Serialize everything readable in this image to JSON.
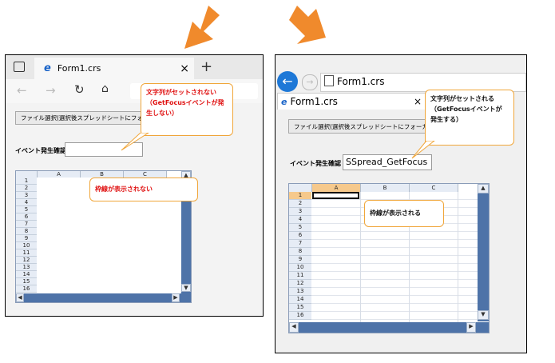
{
  "colors": {
    "accent_orange": "#f08a2c",
    "callout_red": "#e01010",
    "grid_blue": "#4e73a8",
    "back_button": "#1e78d7"
  },
  "left": {
    "tab_title": "Form1.crs",
    "tab_close": "×",
    "new_tab": "+",
    "button_label": "ファイル選択(選択後スプレッドシートにフォーカス)",
    "event_label": "イベント発生確認",
    "event_value": "",
    "callout_top": "文字列がセットされない\n（GetFocusイベントが発\n生しない）",
    "callout_grid": "枠線が表示されない",
    "columns": [
      "A",
      "B",
      "C"
    ],
    "rows": [
      "1",
      "2",
      "3",
      "4",
      "5",
      "6",
      "7",
      "8",
      "9",
      "10",
      "11",
      "12",
      "13",
      "14",
      "15",
      "16"
    ]
  },
  "right": {
    "address_title": "Form1.crs",
    "tab_title": "Form1.crs",
    "tab_close": "×",
    "button_label": "ファイル選択(選択後スプレッドシートにフォーカス)",
    "event_label": "イベント発生確認",
    "event_value": "SSpread_GetFocus",
    "callout_top": "文字列がセットされる\n（GetFocusイベントが\n発生する）",
    "callout_grid": "枠線が表示される",
    "columns": [
      "A",
      "B",
      "C"
    ],
    "rows": [
      "1",
      "2",
      "3",
      "4",
      "5",
      "6",
      "7",
      "8",
      "9",
      "10",
      "11",
      "12",
      "13",
      "14",
      "15",
      "16"
    ]
  }
}
